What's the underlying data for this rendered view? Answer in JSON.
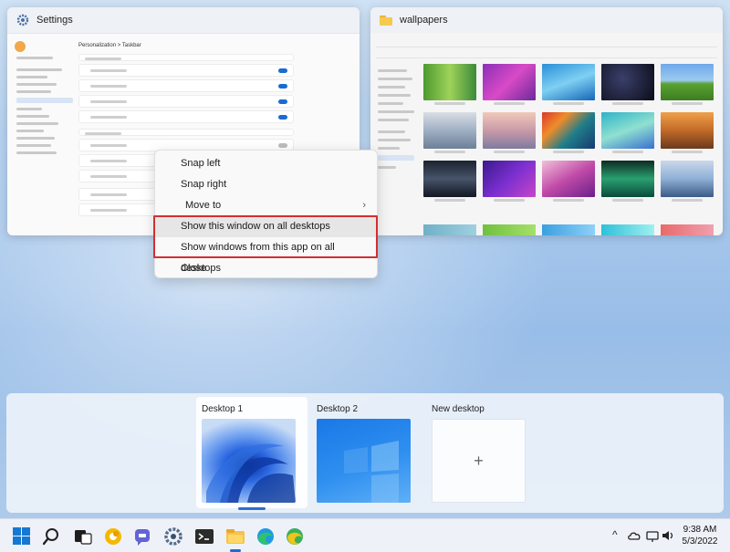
{
  "windows": {
    "settings": {
      "title": "Settings",
      "page_title": "Personalization  >  Taskbar"
    },
    "explorer": {
      "title": "wallpapers"
    }
  },
  "context_menu": {
    "items": [
      {
        "label": "Snap left"
      },
      {
        "label": "Snap right"
      },
      {
        "label": "Move to",
        "has_submenu": true
      },
      {
        "label": "Show this window on all desktops",
        "highlighted": true
      },
      {
        "label": "Show windows from this app on all desktops",
        "highlighted": true
      },
      {
        "label": "Close"
      }
    ],
    "submenu_glyph": "›",
    "highlight_color": "#d32f2f"
  },
  "desktops": [
    {
      "label": "Desktop 1",
      "active": true
    },
    {
      "label": "Desktop 2",
      "active": false
    },
    {
      "label": "New desktop",
      "glyph": "+"
    }
  ],
  "taskbar": {
    "apps": [
      "start-icon",
      "search-icon",
      "task-view-icon",
      "canary-browser-icon",
      "teams-chat-icon",
      "settings-icon",
      "terminal-icon",
      "file-explorer-icon",
      "edge-icon",
      "edge-dev-icon"
    ],
    "tray": {
      "chevron": "^",
      "clock_time": "9:38 AM",
      "clock_date": "5/3/2022"
    }
  },
  "colors": {
    "accent": "#1b6cd0",
    "highlight_border": "#d32f2f"
  }
}
